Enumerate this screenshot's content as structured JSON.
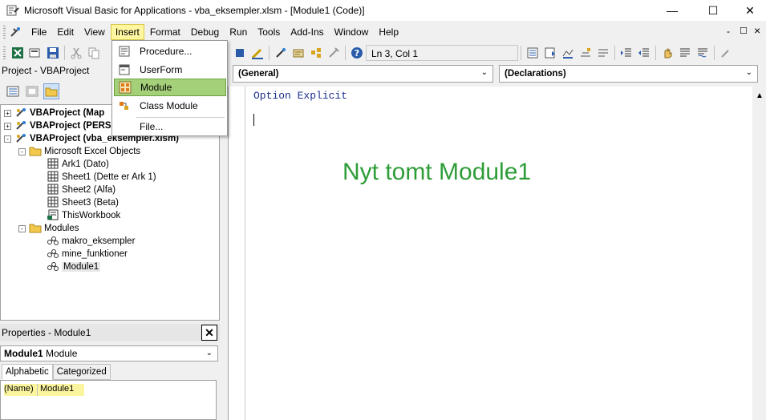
{
  "window": {
    "title": "Microsoft Visual Basic for Applications - vba_eksempler.xlsm - [Module1 (Code)]",
    "minimize": "—",
    "maximize": "☐",
    "close": "✕"
  },
  "menubar": {
    "items": [
      "File",
      "Edit",
      "View",
      "Insert",
      "Format",
      "Debug",
      "Run",
      "Tools",
      "Add-Ins",
      "Window",
      "Help"
    ],
    "active": "Insert",
    "mdi_controls": [
      "-",
      "☐",
      "×"
    ]
  },
  "toolbar": {
    "position": "Ln 3, Col 1"
  },
  "insert_menu": {
    "items": [
      {
        "label": "Procedure...",
        "icon": "procedure-icon"
      },
      {
        "label": "UserForm",
        "icon": "userform-icon"
      },
      {
        "label": "Module",
        "icon": "module-icon",
        "highlighted": true
      },
      {
        "label": "Class Module",
        "icon": "class-module-icon"
      },
      {
        "label": "File...",
        "icon": ""
      }
    ]
  },
  "project": {
    "title": "Project - VBAProject",
    "tree": [
      {
        "label": "VBAProject (Map",
        "bold": true,
        "level": 0,
        "expander": "+"
      },
      {
        "label": "VBAProject (PERS",
        "bold": true,
        "level": 0,
        "expander": "+"
      },
      {
        "label": "VBAProject (vba_eksempler.xlsm)",
        "bold": true,
        "level": 0,
        "expander": "-"
      },
      {
        "label": "Microsoft Excel Objects",
        "level": 1,
        "expander": "-"
      },
      {
        "label": "Ark1 (Dato)",
        "level": 2
      },
      {
        "label": "Sheet1 (Dette er Ark 1)",
        "level": 2
      },
      {
        "label": "Sheet2 (Alfa)",
        "level": 2
      },
      {
        "label": "Sheet3 (Beta)",
        "level": 2
      },
      {
        "label": "ThisWorkbook",
        "level": 2
      },
      {
        "label": "Modules",
        "level": 1,
        "expander": "-"
      },
      {
        "label": "makro_eksempler",
        "level": 2
      },
      {
        "label": "mine_funktioner",
        "level": 2
      },
      {
        "label": "Module1",
        "level": 2,
        "selected": true
      }
    ]
  },
  "properties": {
    "title": "Properties - Module1",
    "close": "✕",
    "object_name": "Module1",
    "object_type": "Module",
    "tabs": [
      "Alphabetic",
      "Categorized"
    ],
    "rows": [
      {
        "name": "(Name)",
        "value": "Module1"
      }
    ]
  },
  "code": {
    "object_dropdown": "(General)",
    "procedure_dropdown": "(Declarations)",
    "lines": [
      "Option Explicit"
    ],
    "annotation": "Nyt tomt Module1"
  },
  "colors": {
    "annotation": "#2e9d38",
    "keyword": "#1a2f8c",
    "menu_active": "#fff6a0",
    "menu_highlight": "#a5d07a"
  }
}
